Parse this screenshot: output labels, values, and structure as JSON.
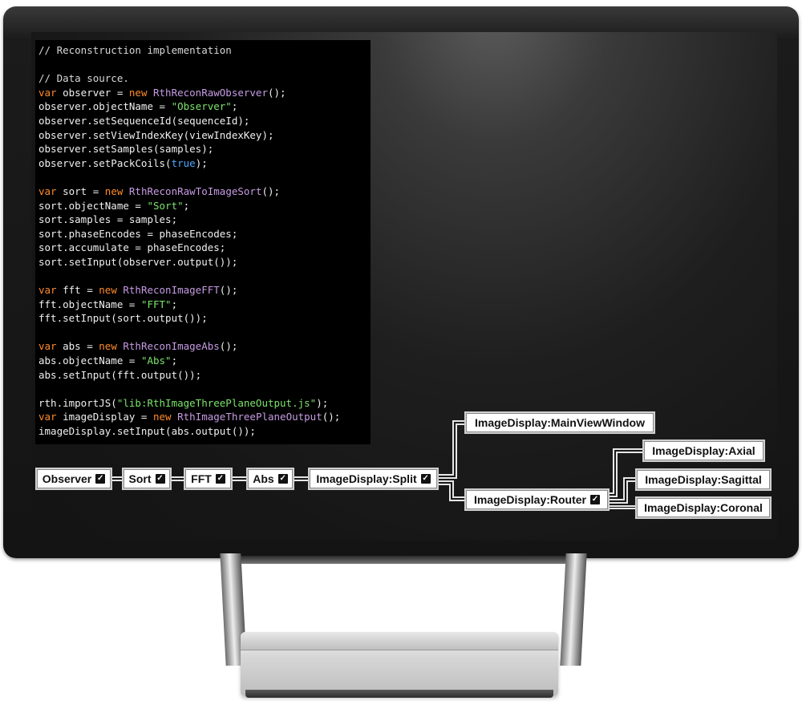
{
  "code": {
    "lines": [
      [
        {
          "t": "// Reconstruction implementation",
          "c": "cmt"
        }
      ],
      [],
      [
        {
          "t": "// Data source.",
          "c": "cmt"
        }
      ],
      [
        {
          "t": "var",
          "c": "kw"
        },
        {
          "t": " observer = "
        },
        {
          "t": "new",
          "c": "kw"
        },
        {
          "t": " "
        },
        {
          "t": "RthReconRawObserver",
          "c": "cls"
        },
        {
          "t": "();"
        }
      ],
      [
        {
          "t": "observer.objectName = "
        },
        {
          "t": "\"Observer\"",
          "c": "str"
        },
        {
          "t": ";"
        }
      ],
      [
        {
          "t": "observer.setSequenceId(sequenceId);"
        }
      ],
      [
        {
          "t": "observer.setViewIndexKey(viewIndexKey);"
        }
      ],
      [
        {
          "t": "observer.setSamples(samples);"
        }
      ],
      [
        {
          "t": "observer.setPackCoils("
        },
        {
          "t": "true",
          "c": "bool"
        },
        {
          "t": ");"
        }
      ],
      [],
      [
        {
          "t": "var",
          "c": "kw"
        },
        {
          "t": " sort = "
        },
        {
          "t": "new",
          "c": "kw"
        },
        {
          "t": " "
        },
        {
          "t": "RthReconRawToImageSort",
          "c": "cls"
        },
        {
          "t": "();"
        }
      ],
      [
        {
          "t": "sort.objectName = "
        },
        {
          "t": "\"Sort\"",
          "c": "str"
        },
        {
          "t": ";"
        }
      ],
      [
        {
          "t": "sort.samples = samples;"
        }
      ],
      [
        {
          "t": "sort.phaseEncodes = phaseEncodes;"
        }
      ],
      [
        {
          "t": "sort.accumulate = phaseEncodes;"
        }
      ],
      [
        {
          "t": "sort.setInput(observer.output());"
        }
      ],
      [],
      [
        {
          "t": "var",
          "c": "kw"
        },
        {
          "t": " fft = "
        },
        {
          "t": "new",
          "c": "kw"
        },
        {
          "t": " "
        },
        {
          "t": "RthReconImageFFT",
          "c": "cls"
        },
        {
          "t": "();"
        }
      ],
      [
        {
          "t": "fft.objectName = "
        },
        {
          "t": "\"FFT\"",
          "c": "str"
        },
        {
          "t": ";"
        }
      ],
      [
        {
          "t": "fft.setInput(sort.output());"
        }
      ],
      [],
      [
        {
          "t": "var",
          "c": "kw"
        },
        {
          "t": " abs = "
        },
        {
          "t": "new",
          "c": "kw"
        },
        {
          "t": " "
        },
        {
          "t": "RthReconImageAbs",
          "c": "cls"
        },
        {
          "t": "();"
        }
      ],
      [
        {
          "t": "abs.objectName = "
        },
        {
          "t": "\"Abs\"",
          "c": "str"
        },
        {
          "t": ";"
        }
      ],
      [
        {
          "t": "abs.setInput(fft.output());"
        }
      ],
      [],
      [
        {
          "t": "rth.importJS("
        },
        {
          "t": "\"lib:RthImageThreePlaneOutput.js\"",
          "c": "str"
        },
        {
          "t": ");"
        }
      ],
      [
        {
          "t": "var",
          "c": "kw"
        },
        {
          "t": " imageDisplay = "
        },
        {
          "t": "new",
          "c": "kw"
        },
        {
          "t": " "
        },
        {
          "t": "RthImageThreePlaneOutput",
          "c": "cls"
        },
        {
          "t": "();"
        }
      ],
      [
        {
          "t": "imageDisplay.setInput(abs.output());"
        }
      ]
    ]
  },
  "pipeline": {
    "check_glyph": "✓",
    "nodes": {
      "observer": {
        "label": "Observer",
        "checked": true
      },
      "sort": {
        "label": "Sort",
        "checked": true
      },
      "fft": {
        "label": "FFT",
        "checked": true
      },
      "abs": {
        "label": "Abs",
        "checked": true
      },
      "split": {
        "label": "ImageDisplay:Split",
        "checked": true
      },
      "mainview": {
        "label": "ImageDisplay:MainViewWindow",
        "checked": false
      },
      "router": {
        "label": "ImageDisplay:Router",
        "checked": true
      },
      "axial": {
        "label": "ImageDisplay:Axial",
        "checked": false
      },
      "sagittal": {
        "label": "ImageDisplay:Sagittal",
        "checked": false
      },
      "coronal": {
        "label": "ImageDisplay:Coronal",
        "checked": false
      }
    }
  },
  "colors": {
    "keyword": "#ff8a2a",
    "class": "#c79be3",
    "string": "#7be36b",
    "boolean": "#4aa8ff",
    "wire": "#e6e6e6"
  }
}
